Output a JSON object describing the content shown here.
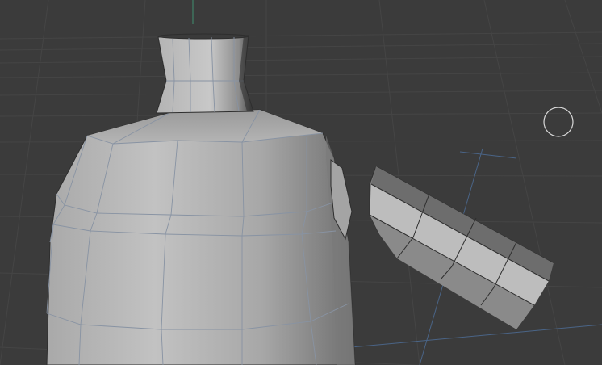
{
  "viewport": {
    "background": "#3b3b3b",
    "grid_color": "#4a4a4a",
    "axis_y_color": "#3f8f6f",
    "axis_x_color": "#4e6f9a",
    "mesh_edge_color": "#7d8796",
    "mesh_outline_color": "#2e2e2e"
  },
  "scene": {
    "objects": [
      {
        "name": "body"
      },
      {
        "name": "neck"
      },
      {
        "name": "arm"
      }
    ]
  },
  "gizmo": {
    "icon": "circle-pivot-icon"
  }
}
